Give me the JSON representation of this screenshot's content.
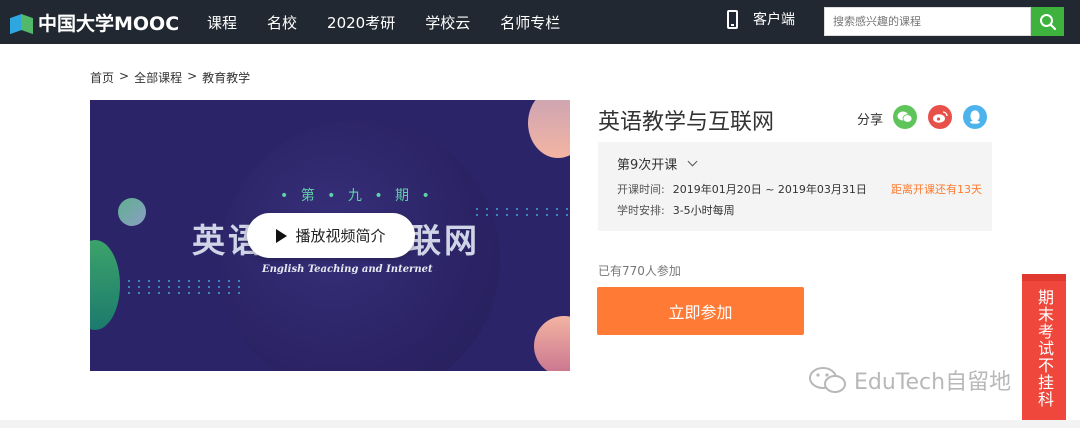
{
  "header": {
    "logo_text": "中国大学MOOC",
    "nav": [
      "课程",
      "名校",
      "2020考研",
      "学校云",
      "名师专栏"
    ],
    "client_label": "客户端",
    "search_placeholder": "搜索感兴趣的课程",
    "colors": {
      "bar": "#222831",
      "search_button": "#3db33d"
    },
    "icons": {
      "client": "phone-icon",
      "search": "search-icon"
    }
  },
  "breadcrumb": [
    "首页",
    ">",
    "全部课程",
    ">",
    "教育教学"
  ],
  "video": {
    "edition": "• 第 • 九 • 期 •",
    "banner_title": "英语教学与互联网",
    "banner_subtitle": "English Teaching and Internet",
    "play_label": "播放视频简介"
  },
  "course": {
    "title": "英语教学与互联网",
    "share_label": "分享",
    "share_icons": [
      "wechat-icon",
      "weibo-icon",
      "qq-icon"
    ],
    "term_label": "第9次开课",
    "schedule_label": "开课时间:",
    "schedule_value": "2019年01月20日 ~ 2019年03月31日",
    "countdown": "距离开课还有13天",
    "hours_label": "学时安排:",
    "hours_value": "3-5小时每周",
    "joined": "已有770人参加",
    "enroll_label": "立即参加",
    "colors": {
      "enroll": "#ff7a34",
      "countdown": "#ff7a2f"
    }
  },
  "side_badge": "期末考试不挂科",
  "watermark": "EduTech自留地"
}
